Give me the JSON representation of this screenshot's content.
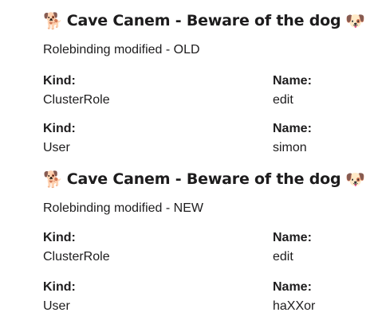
{
  "messages": [
    {
      "title": "Cave Canem - Beware of the dog",
      "title_emoji_left": "🐕",
      "title_emoji_right": "🐶",
      "subtitle": "Rolebinding modified - OLD",
      "rows": [
        {
          "left": {
            "label": "Kind:",
            "value": "ClusterRole"
          },
          "right": {
            "label": "Name:",
            "value": "edit"
          }
        },
        {
          "left": {
            "label": "Kind:",
            "value": "User"
          },
          "right": {
            "label": "Name:",
            "value": "simon"
          }
        }
      ]
    },
    {
      "title": "Cave Canem - Beware of the dog",
      "title_emoji_left": "🐕",
      "title_emoji_right": "🐶",
      "subtitle": "Rolebinding modified - NEW",
      "rows": [
        {
          "left": {
            "label": "Kind:",
            "value": "ClusterRole"
          },
          "right": {
            "label": "Name:",
            "value": "edit"
          }
        },
        {
          "left": {
            "label": "Kind:",
            "value": "User"
          },
          "right": {
            "label": "Name:",
            "value": "haXXor"
          }
        }
      ]
    }
  ]
}
